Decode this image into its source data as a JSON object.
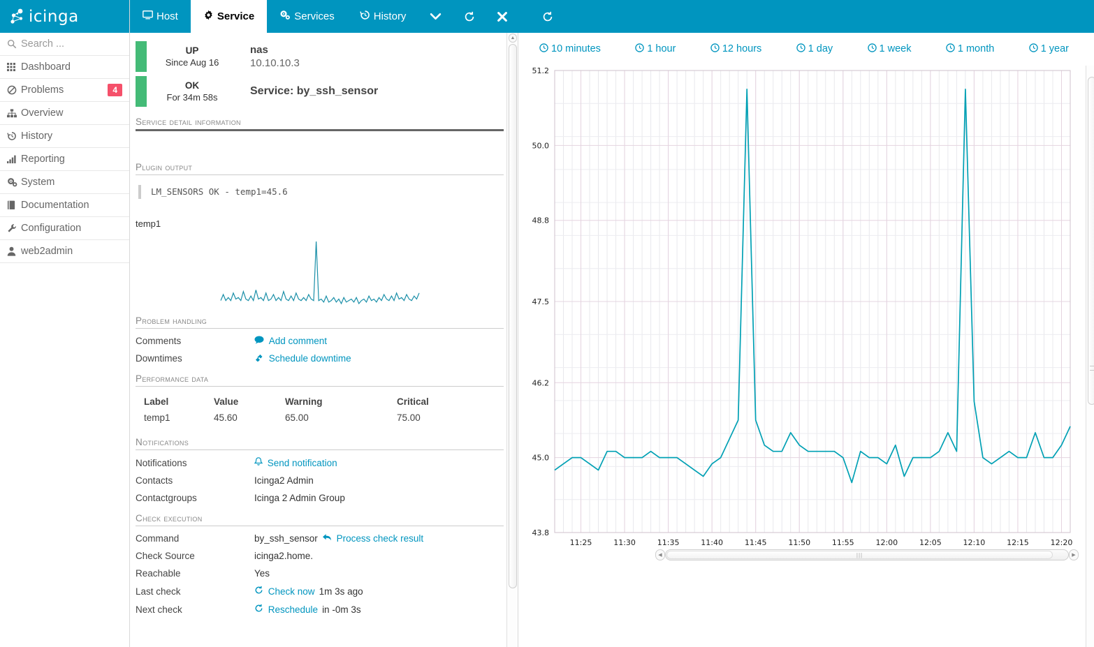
{
  "brand": {
    "name": "icinga",
    "color": "#0095bf",
    "badge_color": "#f5506a",
    "ok_color": "#44bb77"
  },
  "sidebar": {
    "search_placeholder": "Search ...",
    "items": [
      {
        "label": "Search ...",
        "icon": "search-icon",
        "name": "search"
      },
      {
        "label": "Dashboard",
        "icon": "grid-icon",
        "name": "dashboard"
      },
      {
        "label": "Problems",
        "icon": "ban-icon",
        "name": "problems",
        "badge": "4"
      },
      {
        "label": "Overview",
        "icon": "sitemap-icon",
        "name": "overview"
      },
      {
        "label": "History",
        "icon": "history-icon",
        "name": "history"
      },
      {
        "label": "Reporting",
        "icon": "bar-chart-icon",
        "name": "reporting"
      },
      {
        "label": "System",
        "icon": "cogs-icon",
        "name": "system"
      },
      {
        "label": "Documentation",
        "icon": "book-icon",
        "name": "documentation"
      },
      {
        "label": "Configuration",
        "icon": "wrench-icon",
        "name": "configuration"
      },
      {
        "label": "web2admin",
        "icon": "user-icon",
        "name": "user"
      }
    ]
  },
  "tabs": [
    {
      "label": "Host",
      "icon": "monitor-icon",
      "active": false
    },
    {
      "label": "Service",
      "icon": "gear-icon",
      "active": true
    },
    {
      "label": "Services",
      "icon": "cogs-icon",
      "active": false
    },
    {
      "label": "History",
      "icon": "history-icon",
      "active": false
    }
  ],
  "tab_controls": [
    {
      "icon": "chevron-down-icon",
      "glyph": "⌄"
    },
    {
      "icon": "refresh-icon",
      "glyph": "⟳"
    },
    {
      "icon": "close-icon",
      "glyph": "✕"
    },
    {
      "icon": "refresh-icon-secondary",
      "glyph": "⟳"
    }
  ],
  "detail": {
    "host_status": {
      "state": "UP",
      "since": "Since Aug 16",
      "host": "nas",
      "address": "10.10.10.3"
    },
    "service_status": {
      "state": "OK",
      "since": "For 34m 58s",
      "service_label": "Service: by_ssh_sensor"
    },
    "section_title": "SERVICE DETAIL INFORMATION",
    "plugin_output": {
      "title": "Plugin Output",
      "text": "LM_SENSORS OK - temp1=45.6"
    },
    "graph_label": "temp1",
    "problem_handling": {
      "title": "Problem handling",
      "rows": [
        {
          "key": "Comments",
          "link": "Add comment",
          "icon": "comment-icon"
        },
        {
          "key": "Downtimes",
          "link": "Schedule downtime",
          "icon": "plug-icon"
        }
      ]
    },
    "performance_data": {
      "title": "Performance data",
      "headers": [
        "Label",
        "Value",
        "Warning",
        "Critical"
      ],
      "rows": [
        [
          "temp1",
          "45.60",
          "65.00",
          "75.00"
        ]
      ]
    },
    "notifications": {
      "title": "Notifications",
      "rows": [
        {
          "key": "Notifications",
          "link": "Send notification",
          "icon": "bell-icon"
        },
        {
          "key": "Contacts",
          "value": "Icinga2 Admin"
        },
        {
          "key": "Contactgroups",
          "value": "Icinga 2 Admin Group"
        }
      ]
    },
    "check_execution": {
      "title": "Check execution",
      "rows": [
        {
          "key": "Command",
          "value": "by_ssh_sensor",
          "link": "Process check result",
          "icon": "reply-icon"
        },
        {
          "key": "Check Source",
          "value": "icinga2.home."
        },
        {
          "key": "Reachable",
          "value": "Yes"
        },
        {
          "key": "Last check",
          "link": "Check now",
          "icon": "refresh-icon",
          "value": "1m 3s ago"
        },
        {
          "key": "Next check",
          "link": "Reschedule",
          "icon": "refresh-icon",
          "value": "in -0m 3s"
        }
      ]
    }
  },
  "timeranges": [
    {
      "label": "10 minutes"
    },
    {
      "label": "1 hour"
    },
    {
      "label": "12 hours"
    },
    {
      "label": "1 day"
    },
    {
      "label": "1 week"
    },
    {
      "label": "1 month"
    },
    {
      "label": "1 year"
    }
  ],
  "chart_data": {
    "type": "line",
    "title": "",
    "xlabel": "",
    "ylabel": "",
    "ylim": [
      43.8,
      51.2
    ],
    "grid": true,
    "legend": null,
    "line_color": "#00a0b4",
    "yticks": [
      43.8,
      45.0,
      46.2,
      47.5,
      48.8,
      50.0,
      51.2
    ],
    "xticks": [
      "11:25",
      "11:30",
      "11:35",
      "11:40",
      "11:45",
      "11:50",
      "11:55",
      "12:00",
      "12:05",
      "12:10",
      "12:15",
      "12:20"
    ],
    "xlim": [
      "11:22",
      "12:21"
    ],
    "series": [
      {
        "name": "temp1",
        "x": [
          "11:22",
          "11:23",
          "11:24",
          "11:25",
          "11:26",
          "11:27",
          "11:28",
          "11:29",
          "11:30",
          "11:31",
          "11:32",
          "11:33",
          "11:34",
          "11:35",
          "11:36",
          "11:37",
          "11:38",
          "11:39",
          "11:40",
          "11:41",
          "11:42",
          "11:43",
          "11:44",
          "11:45",
          "11:46",
          "11:47",
          "11:48",
          "11:49",
          "11:50",
          "11:51",
          "11:52",
          "11:53",
          "11:54",
          "11:55",
          "11:56",
          "11:57",
          "11:58",
          "11:59",
          "12:00",
          "12:01",
          "12:02",
          "12:03",
          "12:04",
          "12:05",
          "12:06",
          "12:07",
          "12:08",
          "12:09",
          "12:10",
          "12:11",
          "12:12",
          "12:13",
          "12:14",
          "12:15",
          "12:16",
          "12:17",
          "12:18",
          "12:19",
          "12:20",
          "12:21"
        ],
        "y": [
          44.8,
          44.9,
          45.0,
          45.0,
          44.9,
          44.8,
          45.1,
          45.1,
          45.0,
          45.0,
          45.0,
          45.1,
          45.0,
          45.0,
          45.0,
          44.9,
          44.8,
          44.7,
          44.9,
          45.0,
          45.3,
          45.6,
          50.9,
          45.6,
          45.2,
          45.1,
          45.1,
          45.4,
          45.2,
          45.1,
          45.1,
          45.1,
          45.1,
          45.0,
          44.6,
          45.1,
          45.0,
          45.0,
          44.9,
          45.2,
          44.7,
          45.0,
          45.0,
          45.0,
          45.1,
          45.4,
          45.1,
          50.9,
          45.9,
          45.0,
          44.9,
          45.0,
          45.1,
          45.0,
          45.0,
          45.4,
          45.0,
          45.0,
          45.2,
          45.5
        ]
      }
    ]
  },
  "sparkline": {
    "values": [
      45.0,
      45.4,
      45.0,
      45.2,
      45.0,
      45.5,
      45.1,
      45.2,
      45.0,
      45.6,
      45.1,
      45.0,
      45.3,
      45.0,
      45.7,
      45.1,
      45.2,
      45.0,
      45.5,
      45.0,
      45.1,
      45.4,
      45.0,
      45.2,
      45.0,
      45.6,
      45.1,
      45.0,
      45.3,
      45.0,
      45.5,
      45.1,
      45.0,
      45.2,
      45.0,
      45.4,
      45.1,
      45.0,
      48.9,
      45.0,
      45.1,
      44.9,
      45.3,
      44.9,
      45.0,
      45.2,
      44.9,
      45.1,
      44.8,
      45.2,
      44.9,
      45.0,
      45.1,
      44.9,
      45.2,
      44.8,
      45.0,
      45.1,
      44.9,
      45.3,
      45.0,
      45.1,
      44.9,
      45.2,
      45.0,
      45.4,
      45.1,
      45.0,
      45.3,
      45.0,
      45.5,
      45.1,
      45.2,
      45.0,
      45.4,
      45.1,
      45.0,
      45.3,
      45.1,
      45.5
    ]
  }
}
